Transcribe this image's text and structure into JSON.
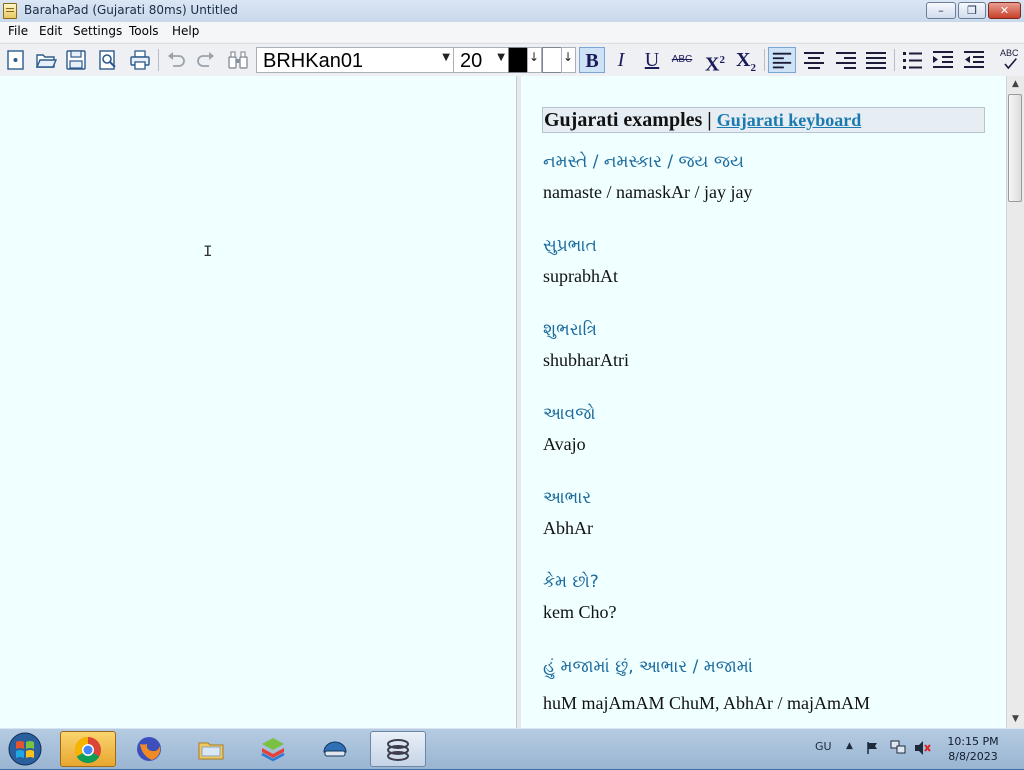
{
  "window": {
    "title": "BarahaPad (Gujarati 80ms) Untitled"
  },
  "window_controls": {
    "minimize": "–",
    "maximize": "❐",
    "close": "✕"
  },
  "menu": [
    "File",
    "Edit",
    "Settings",
    "Tools",
    "Help"
  ],
  "toolbar": {
    "font_name": "BRHKan01",
    "font_size": "20",
    "text_color": "#000000",
    "highlight_color": "#ffffff",
    "bold": "B",
    "italic": "I",
    "underline": "U",
    "strike": "ABC",
    "superscript_base": "X",
    "superscript_mark": "2",
    "subscript_base": "X",
    "subscript_mark": "2",
    "spellcheck": "ABC",
    "icons": [
      "new-document",
      "open-folder",
      "save",
      "print-preview",
      "print",
      "undo",
      "redo",
      "binoculars-find",
      "align-left",
      "align-center",
      "align-right",
      "justify",
      "bullets",
      "increase-indent",
      "decrease-indent",
      "spellcheck"
    ]
  },
  "reference": {
    "header_title": "Gujarati examples | ",
    "header_link": "Gujarati keyboard",
    "examples": [
      {
        "gujarati": "નમસ્તે / નમસ્કાર / જય જય",
        "translit": "namaste / namaskAr / jay jay"
      },
      {
        "gujarati": "સુપ્રભાત",
        "translit": "suprabhAt"
      },
      {
        "gujarati": "શુભરાત્રિ",
        "translit": "shubharAtri"
      },
      {
        "gujarati": "આવજો",
        "translit": "Avajo"
      },
      {
        "gujarati": "આભાર",
        "translit": "AbhAr"
      },
      {
        "gujarati": "કેમ છો?",
        "translit": "kem Cho?"
      },
      {
        "gujarati": "હું મજામાં છું, આભાર / મજામાં",
        "translit": "huM majAmAM ChuM, AbhAr / majAmAM"
      }
    ]
  },
  "taskbar": {
    "apps": [
      "windows-start",
      "chrome",
      "firefox",
      "file-explorer",
      "bluestacks",
      "vpn-helmet",
      "barahapad"
    ],
    "language": "GU",
    "time": "10:15 PM",
    "date": "8/8/2023"
  }
}
